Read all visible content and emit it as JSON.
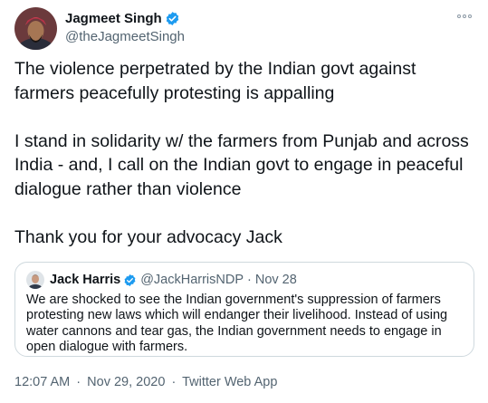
{
  "author": {
    "display_name": "Jagmeet Singh",
    "handle": "@theJagmeetSingh",
    "verified_icon": "verified-badge-icon",
    "avatar": "profile-photo"
  },
  "more_icon": "more-options-icon",
  "tweet": {
    "paragraphs": [
      "The violence perpetrated by the Indian govt against farmers peacefully protesting is appalling",
      "I stand in solidarity w/ the farmers from Punjab and across India - and, I call on the Indian govt to engage in peaceful dialogue rather than violence",
      "Thank you for your advocacy Jack"
    ]
  },
  "quoted_tweet": {
    "display_name": "Jack Harris",
    "handle": "@JackHarrisNDP",
    "separator": "·",
    "date": "Nov 28",
    "text": "We are shocked to see the Indian government's suppression of farmers protesting new laws which will endanger their livelihood. Instead of using water cannons and tear gas, the Indian government needs to engage in open dialogue with farmers."
  },
  "footer": {
    "time": "12:07 AM",
    "separator1": "·",
    "date": "Nov 29, 2020",
    "separator2": "·",
    "source": "Twitter Web App"
  },
  "colors": {
    "verified_blue": "#1d9bf0",
    "secondary_text": "#536471",
    "primary_text": "#0f1419",
    "border": "#cfd9de"
  }
}
